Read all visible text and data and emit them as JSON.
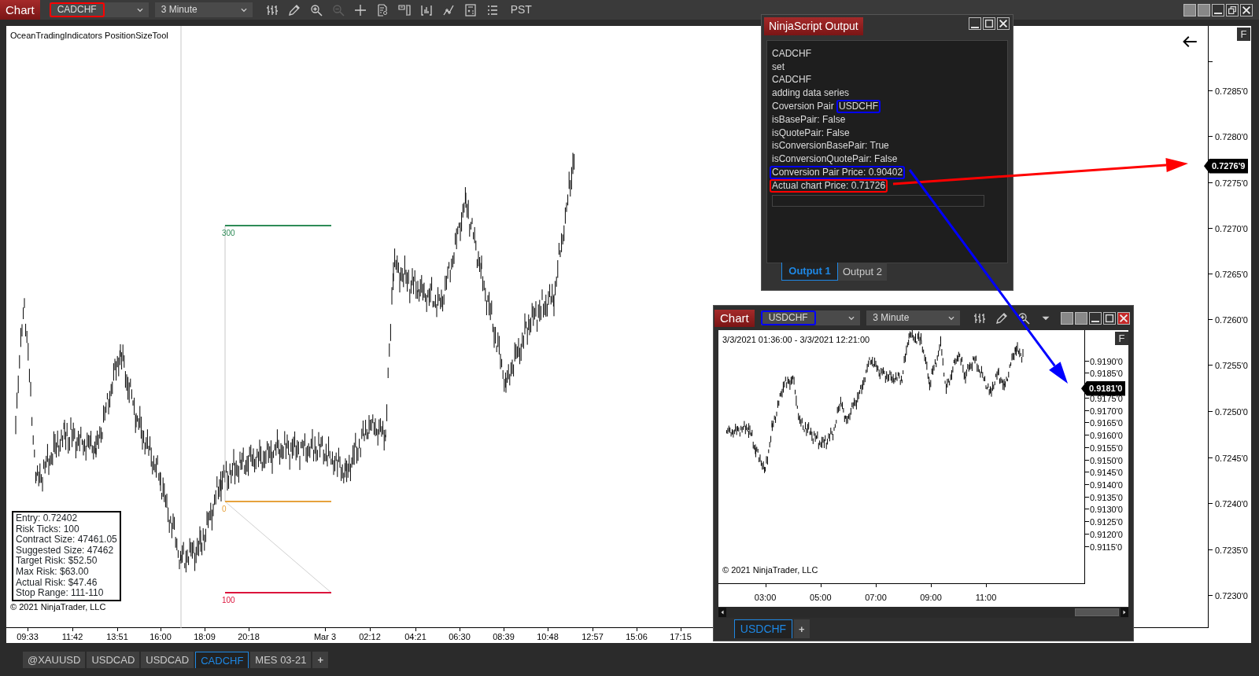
{
  "toolbar": {
    "title": "Chart",
    "instrument": {
      "text": "CADCHF",
      "color": "#ff0000"
    },
    "interval": "3 Minute",
    "timezone": "PST",
    "tools": [
      {
        "kind": "bars",
        "disabled": false
      },
      {
        "kind": "pencil",
        "disabled": false
      },
      {
        "kind": "zoom-in",
        "disabled": false
      },
      {
        "kind": "zoom-out",
        "disabled": true
      },
      {
        "kind": "crosshair",
        "disabled": false
      },
      {
        "kind": "data-box",
        "disabled": false
      },
      {
        "kind": "split",
        "disabled": false
      },
      {
        "kind": "bar-chart",
        "disabled": false
      },
      {
        "kind": "line-chart",
        "disabled": false
      },
      {
        "kind": "calculator",
        "disabled": false
      },
      {
        "kind": "list",
        "disabled": false
      }
    ]
  },
  "chart": {
    "indicator_label": "OceanTradingIndicators PositionSizeTool",
    "position_tool": [
      {
        "kind": "target",
        "label": "300",
        "color": "#2e8b57"
      },
      {
        "kind": "entry",
        "label": "0",
        "color": "#e6a23c"
      },
      {
        "kind": "stop",
        "label": "100",
        "color": "#dc143c"
      }
    ],
    "info_box": [
      "Entry: 0.72402",
      "Risk Ticks: 100",
      "Contract Size: 47461.05",
      "Suggested Size: 47462",
      "Target Risk: $52.50",
      "Max Risk: $63.00",
      "Actual Risk: $47.46",
      "Stop Range: 111-110"
    ],
    "copyright": "© 2021 NinjaTrader, LLC",
    "flag": "F",
    "price_axis": {
      "labels": [
        "0.7285'0",
        "0.7280'0",
        "0.7275'0",
        "0.7270'0",
        "0.7265'0",
        "0.7260'0",
        "0.7255'0",
        "0.7250'0",
        "0.7245'0",
        "0.7240'0",
        "0.7235'0",
        "0.7230'0"
      ],
      "current_price": "0.7276'9"
    },
    "time_axis": [
      "09:33",
      "11:42",
      "13:51",
      "16:00",
      "18:09",
      "20:18",
      "Mar 3",
      "02:12",
      "04:21",
      "06:30",
      "08:39",
      "10:48",
      "12:57",
      "15:06",
      "17:15"
    ]
  },
  "output_window": {
    "title": "NinjaScript Output",
    "lines": [
      {
        "text": "CADCHF"
      },
      {
        "text": "set"
      },
      {
        "text": "CADCHF"
      },
      {
        "text": "adding data series"
      },
      {
        "text": "Coversion Pair",
        "highlight": {
          "text": "USDCHF",
          "color": "#0000ff"
        }
      },
      {
        "text": "isBasePair: False"
      },
      {
        "text": "isQuotePair: False"
      },
      {
        "text": "isConversionBasePair: True"
      },
      {
        "text": "isConversionQuotePair: False"
      },
      {
        "text": "Conversion Pair Price: 0.90402",
        "color": "#0000ff"
      },
      {
        "text": "Actual chart Price: 0.71726",
        "color": "#ff0000"
      }
    ],
    "tabs": [
      {
        "label": "Output 1",
        "selected": true
      },
      {
        "label": "Output 2",
        "selected": false
      }
    ]
  },
  "inset_chart": {
    "title": "Chart",
    "instrument": {
      "text": "USDCHF",
      "color": "#0000ff"
    },
    "interval": "3 Minute",
    "range_label": "3/3/2021 01:36:00 - 3/3/2021 12:21:00",
    "copyright": "© 2021 NinjaTrader, LLC",
    "flag": "F",
    "price_axis": {
      "labels": [
        "0.9190'0",
        "0.9185'0",
        "0.9175'0",
        "0.9170'0",
        "0.9165'0",
        "0.9160'0",
        "0.9155'0",
        "0.9150'0",
        "0.9145'0",
        "0.9140'0",
        "0.9135'0",
        "0.9130'0",
        "0.9125'0",
        "0.9120'0",
        "0.9115'0"
      ],
      "current_price": "0.9181'0"
    },
    "time_axis": [
      "03:00",
      "05:00",
      "07:00",
      "09:00",
      "11:00"
    ],
    "tabs": [
      {
        "label": "USDCHF",
        "selected": true
      }
    ],
    "add_tab": "+"
  },
  "annotations": [
    {
      "kind": "arrow",
      "color": "#ff0000"
    },
    {
      "kind": "arrow",
      "color": "#0000ff"
    }
  ],
  "tabs": [
    {
      "label": "@XAUUSD",
      "selected": false
    },
    {
      "label": "USDCAD",
      "selected": false
    },
    {
      "label": "USDCAD",
      "selected": false
    },
    {
      "label": "CADCHF",
      "selected": true
    },
    {
      "label": "MES 03-21",
      "selected": false
    }
  ],
  "add_tab": "+"
}
